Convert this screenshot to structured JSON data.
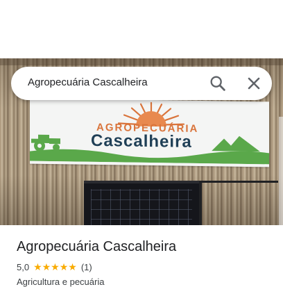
{
  "search": {
    "query": "Agropecuária Cascalheira"
  },
  "banner": {
    "line1": "AGROPECUÁRIA",
    "line2": "Cascalheira"
  },
  "place": {
    "title": "Agropecuária Cascalheira",
    "rating": "5,0",
    "stars": "★★★★★",
    "review_count": "(1)",
    "category": "Agricultura e pecuária"
  },
  "colors": {
    "star": "#f9ab00",
    "banner_orange": "#d9743b",
    "banner_navy": "#1f3f56",
    "banner_green": "#5aa84a"
  }
}
